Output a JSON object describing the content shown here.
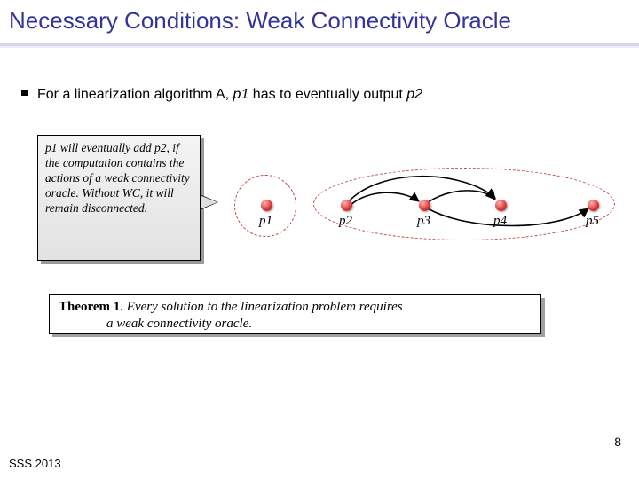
{
  "title": "Necessary Conditions: Weak Connectivity Oracle",
  "bullet": {
    "pre": "For a linearization algorithm A, ",
    "p1": "p1",
    "mid": " has to eventually output ",
    "p2": "p2"
  },
  "callout": {
    "text": "p1 will eventually add p2, if the computation contains the actions of a weak connectivity oracle. Without WC, it will remain disconnected."
  },
  "nodes": {
    "p1": "p1",
    "p2": "p2",
    "p3": "p3",
    "p4": "p4",
    "p5": "p5"
  },
  "theorem": {
    "label": "Theorem 1",
    "body_line1": ". Every solution to the linearization problem requires",
    "body_line2": "a weak connectivity oracle."
  },
  "page_number": "8",
  "footer": "SSS 2013"
}
